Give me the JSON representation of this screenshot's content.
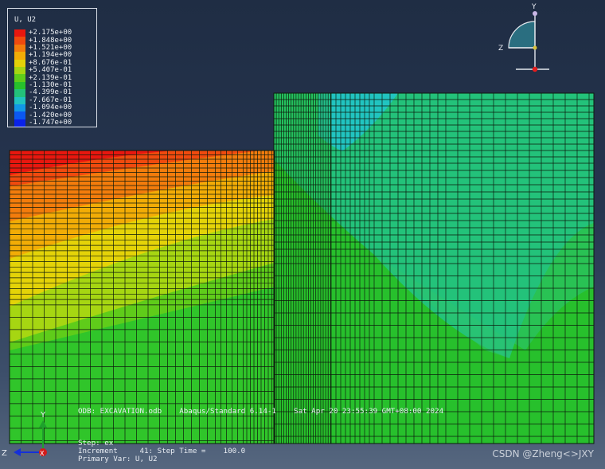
{
  "legend": {
    "title": "U, U2",
    "entries": [
      {
        "value": "+2.175e+00",
        "color": "#e8170f"
      },
      {
        "value": "+1.848e+00",
        "color": "#f04a0e"
      },
      {
        "value": "+1.521e+00",
        "color": "#f37c0c"
      },
      {
        "value": "+1.194e+00",
        "color": "#f2ac06"
      },
      {
        "value": "+8.676e-01",
        "color": "#e4d308"
      },
      {
        "value": "+5.407e-01",
        "color": "#a6d612"
      },
      {
        "value": "+2.139e-01",
        "color": "#5fcc1a"
      },
      {
        "value": "-1.130e-01",
        "color": "#27c02c"
      },
      {
        "value": "-4.399e-01",
        "color": "#23c27a"
      },
      {
        "value": "-7.667e-01",
        "color": "#21c4c0"
      },
      {
        "value": "-1.094e+00",
        "color": "#1298e6"
      },
      {
        "value": "-1.420e+00",
        "color": "#0b58f2"
      },
      {
        "value": "-1.747e+00",
        "color": "#0a22e8"
      }
    ]
  },
  "odb_info": "ODB: EXCAVATION.odb    Abaqus/Standard 6.14-1    Sat Apr 20 23:55:39 GMT+08:00 2024",
  "step_info": {
    "step": "Step: ex",
    "increment": "Increment     41: Step Time =    100.0",
    "primary_var": "Primary Var: U, U2"
  },
  "triad_top": {
    "y": "Y",
    "z": "Z"
  },
  "triad_bottom": {
    "y": "Y",
    "z": "Z",
    "x": "X"
  },
  "watermark": "CSDN @Zheng<>JXY"
}
